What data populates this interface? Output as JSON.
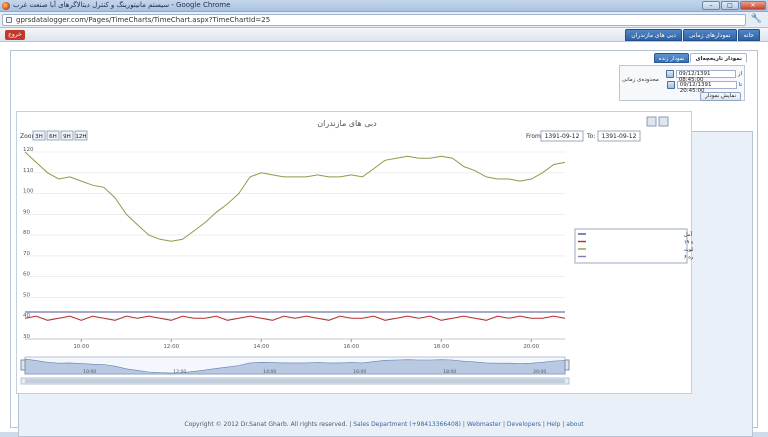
{
  "window": {
    "title": "سیستم مانیتورینگ و کنترل دیتالاگرهای آبا صنعت غرب - Google Chrome",
    "url": "gprsdatalogger.com/Pages/TimeCharts/TimeChart.aspx?TimeChartId=25"
  },
  "topnav": {
    "logout": "خروج",
    "tabs": [
      "خانه",
      "نمودارهای زمانی",
      "دبی های مازندران"
    ]
  },
  "subtabs": [
    "نمودار تاریخچه‌ای",
    "نمودار زنده"
  ],
  "filter": {
    "range_label": "محدوده‌ی زمانی",
    "from_label": "از",
    "to_label": "تا",
    "from_value": "09/12/1391 08:45:00",
    "to_value": "09/12/1391 20:45:00",
    "show_button": "نمایش نمودار"
  },
  "toolbar": {
    "zoom_label": "Zoom",
    "zoom_buttons": [
      "3H",
      "6H",
      "9H",
      "12H"
    ],
    "from_label": "From:",
    "from_value": "1391-09-12",
    "to_label": "To:",
    "to_value": "1391-09-12"
  },
  "colors": {
    "series1": "#4d4f9a",
    "series2": "#b22f2f",
    "series3": "#8b9c4a",
    "series4": "#7d7fb0",
    "navigator_fill": "#b9c9e2",
    "navigator_line": "#5d7fb5"
  },
  "chart_data": {
    "type": "line",
    "title": "دبی های مازندران",
    "xlabel": "",
    "ylabel": "",
    "x_ticks": [
      "10:00",
      "12:00",
      "14:00",
      "16:00",
      "18:00",
      "20:00"
    ],
    "y_ticks": [
      30,
      40,
      50,
      60,
      70,
      80,
      90,
      100,
      110,
      120
    ],
    "ylim": [
      30,
      120
    ],
    "xlim": [
      8.75,
      20.75
    ],
    "grid": true,
    "legend_position": "right",
    "x": [
      8.75,
      9,
      9.25,
      9.5,
      9.75,
      10,
      10.25,
      10.5,
      10.75,
      11,
      11.25,
      11.5,
      11.75,
      12,
      12.25,
      12.5,
      12.75,
      13,
      13.25,
      13.5,
      13.75,
      14,
      14.25,
      14.5,
      14.75,
      15,
      15.25,
      15.5,
      15.75,
      16,
      16.25,
      16.5,
      16.75,
      17,
      17.25,
      17.5,
      17.75,
      18,
      18.25,
      18.5,
      18.75,
      19,
      19.25,
      19.5,
      19.75,
      20,
      20.25,
      20.5,
      20.75
    ],
    "series": [
      {
        "name": "دبی - پایین چای ۳ و ۴ و ۱۴ معزن آمل",
        "values": [
          43,
          43,
          43,
          43,
          43,
          43,
          43,
          43,
          43,
          43,
          43,
          43,
          43,
          43,
          43,
          43,
          43,
          43,
          43,
          43,
          43,
          43,
          43,
          43,
          43,
          43,
          43,
          43,
          43,
          43,
          43,
          43,
          43,
          43,
          43,
          43,
          43,
          43,
          43,
          43,
          43,
          43,
          43,
          43,
          43,
          43,
          43,
          43,
          43
        ]
      },
      {
        "name": "دبی - آمل چاه شماره ۱۹",
        "values": [
          40,
          41,
          39,
          40,
          41,
          39,
          41,
          40,
          39,
          41,
          40,
          41,
          40,
          39,
          41,
          40,
          40,
          41,
          39,
          40,
          41,
          40,
          39,
          41,
          40,
          41,
          40,
          39,
          41,
          40,
          40,
          41,
          39,
          40,
          41,
          40,
          41,
          39,
          40,
          41,
          40,
          39,
          41,
          40,
          41,
          40,
          40,
          41,
          40
        ]
      },
      {
        "name": "دبی - بابل - روشن آباد طلوت",
        "values": [
          120,
          115,
          110,
          107,
          108,
          106,
          104,
          103,
          98,
          90,
          85,
          80,
          78,
          77,
          78,
          82,
          86,
          91,
          95,
          100,
          108,
          110,
          109,
          108,
          108,
          108,
          109,
          108,
          108,
          109,
          108,
          112,
          116,
          117,
          118,
          117,
          117,
          118,
          117,
          113,
          111,
          108,
          107,
          107,
          106,
          107,
          110,
          114,
          115
        ]
      },
      {
        "name": "دبی - آمل چاه شماره ۶",
        "values": [
          null,
          null,
          null,
          null,
          null,
          null,
          null,
          null,
          null,
          null,
          null,
          null,
          null,
          null,
          null,
          null,
          null,
          null,
          null,
          null,
          null,
          null,
          null,
          null,
          null,
          null,
          null,
          null,
          null,
          null,
          null,
          null,
          null,
          null,
          null,
          null,
          null,
          null,
          null,
          null,
          null,
          null,
          null,
          null,
          null,
          null,
          null,
          null,
          null
        ]
      }
    ]
  },
  "footer": {
    "copyright": "Copyright © 2012 Dr.Sanat Gharb. All rights reserved.",
    "links": [
      "Sales Department (+98413366408)",
      "Webmaster",
      "Developers",
      "Help",
      "about"
    ]
  }
}
